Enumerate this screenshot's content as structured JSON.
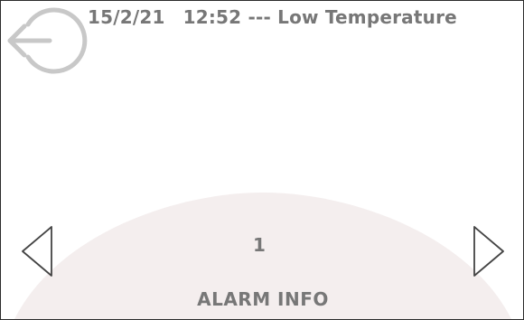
{
  "header": {
    "date": "15/2/21",
    "time": "12:52",
    "separator": "---",
    "message": "Low Temperature"
  },
  "icons": {
    "back": "back-exit-icon",
    "previous": "chevron-left-icon",
    "next": "chevron-right-icon"
  },
  "pager": {
    "current_page": "1"
  },
  "footer": {
    "label": "ALARM INFO"
  },
  "colors": {
    "text": "#777777",
    "icon_stroke": "#c8c8c8",
    "arrow_stroke": "#444444",
    "dome_fill": "#f4eeee",
    "border": "#2b2b2b"
  }
}
